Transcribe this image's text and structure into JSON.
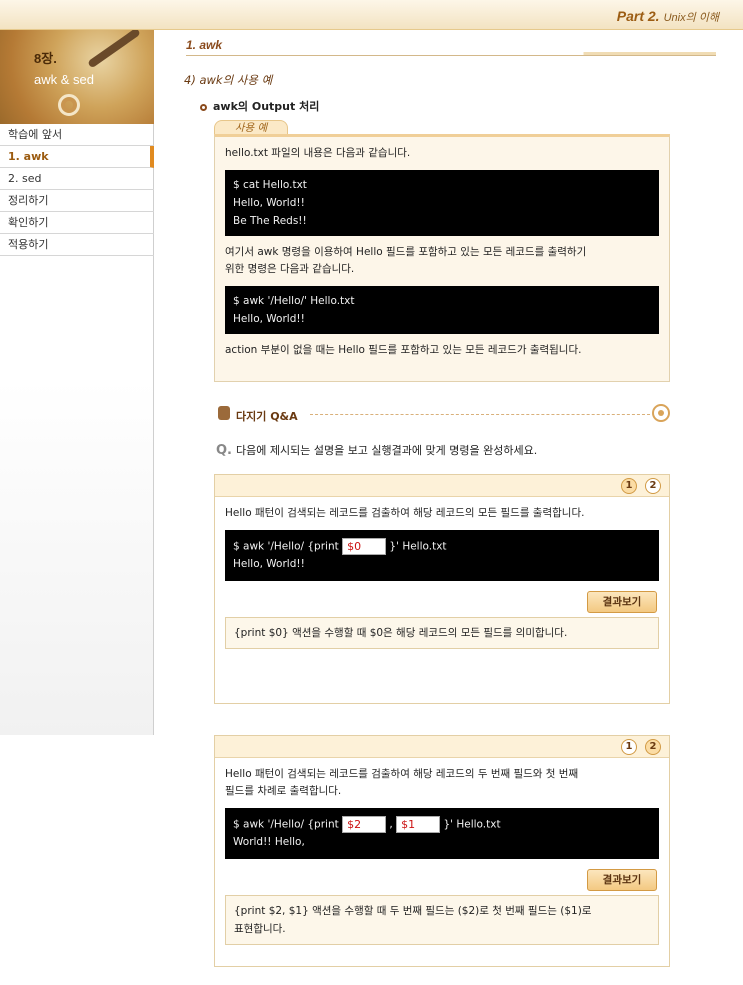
{
  "header": {
    "part_num": "Part 2.",
    "part_title": "Unix의 이해"
  },
  "sidebar": {
    "chapter": "8장.",
    "chapter_sub": "awk & sed",
    "items": [
      {
        "label": "학습에 앞서"
      },
      {
        "label": "1. awk"
      },
      {
        "label": "2. sed"
      },
      {
        "label": "정리하기"
      },
      {
        "label": "확인하기"
      },
      {
        "label": "적용하기"
      }
    ]
  },
  "main": {
    "section_title": "1. awk",
    "subsection_title": "4) awk의 사용 예",
    "bullet_heading": "awk의 Output 처리",
    "example_tab": "사용 예",
    "example": {
      "p1": "hello.txt 파일의 내용은 다음과 같습니다.",
      "term1": [
        "$ cat Hello.txt",
        "Hello, World!!",
        "Be The Reds!!"
      ],
      "p2_line1": "여기서 awk 명령을 이용하여 Hello 필드를 포함하고 있는 모든 레코드를 출력하기",
      "p2_line2": "위한 명령은 다음과 같습니다.",
      "term2": [
        "$ awk '/Hello/' Hello.txt",
        "Hello, World!!"
      ],
      "p3": "action 부분이 없을 때는 Hello 필드를 포함하고 있는 모든 레코드가 출력됩니다."
    },
    "qa": {
      "heading": "다지기 Q&A",
      "q_label": "Q.",
      "question": "다음에 제시되는 설명을 보고 실행결과에 맞게 명령을 완성하세요.",
      "tab1": "1",
      "tab2": "2",
      "result_button": "결과보기",
      "q1": {
        "desc": "Hello 패턴이 검색되는 레코드를 검출하여 해당 레코드의 모든 필드를 출력합니다.",
        "cmd_prefix": "$ awk '/Hello/ {print",
        "answer": "$0",
        "cmd_suffix": "}' Hello.txt",
        "output": "Hello, World!!",
        "result": "{print $0} 액션을 수행할 때 $0은 해당 레코드의 모든 필드를 의미합니다."
      },
      "q2": {
        "desc_line1": "Hello 패턴이 검색되는 레코드를 검출하여 해당 레코드의 두 번째 필드와 첫 번째",
        "desc_line2": "필드를 차례로 출력합니다.",
        "cmd_prefix": "$ awk '/Hello/ {print",
        "answer1": "$2",
        "separator": ",",
        "answer2": "$1",
        "cmd_suffix": "}' Hello.txt",
        "output": "World!! Hello,",
        "result_line1": "{print $2, $1} 액션을 수행할 때 두 번째 필드는 ($2)로 첫 번째 필드는 ($1)로",
        "result_line2": "표현합니다."
      }
    }
  }
}
